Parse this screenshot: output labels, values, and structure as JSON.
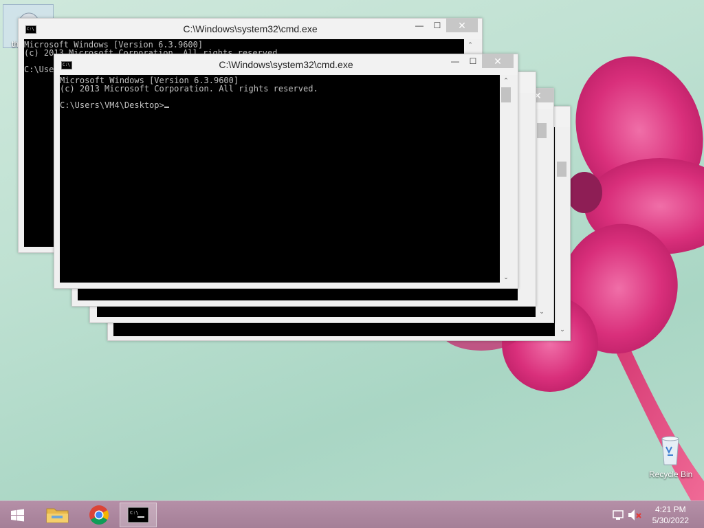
{
  "desktop": {
    "icons": [
      {
        "name": "recycle-bin",
        "label": "Recycle Bin"
      }
    ],
    "top_left_partial_label": "th"
  },
  "windows": [
    {
      "title": "C:\\Windows\\system32\\cmd.exe",
      "lines": [
        "Microsoft Windows [Version 6.3.9600]",
        "(c) 2013 Microsoft Corporation. All rights reserved.",
        "",
        "C:\\Users\\VM4\\Desktop>"
      ]
    },
    {
      "title": "C:\\Windows\\system32\\cmd.exe",
      "lines": [
        "Microsoft Windows [Version 6.3.9600]",
        "(c) 2013 Microsoft Corporation. All rights reserved.",
        "",
        "C:\\Users\\VM4\\Desktop>"
      ]
    }
  ],
  "window_controls": {
    "minimize": "—",
    "maximize": "☐",
    "close": "✕"
  },
  "taskbar": {
    "apps": [
      {
        "name": "file-explorer",
        "active": false
      },
      {
        "name": "chrome",
        "active": false
      },
      {
        "name": "command-prompt",
        "active": true
      }
    ],
    "clock": {
      "time": "4:21 PM",
      "date": "5/30/2022"
    }
  }
}
